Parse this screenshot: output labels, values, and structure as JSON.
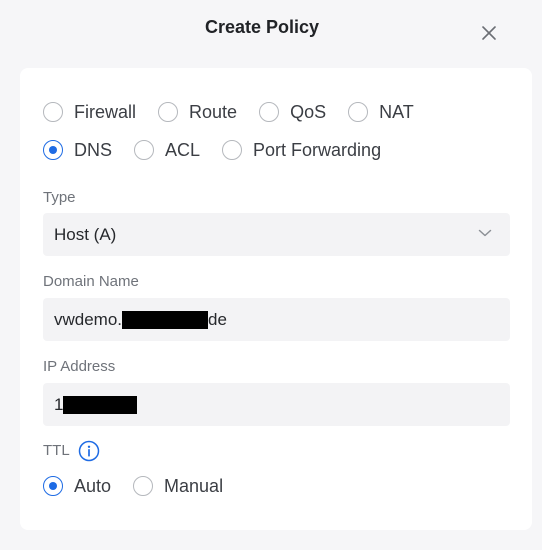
{
  "dialog": {
    "title": "Create Policy"
  },
  "policy_types": {
    "row1": [
      {
        "label": "Firewall",
        "selected": false
      },
      {
        "label": "Route",
        "selected": false
      },
      {
        "label": "QoS",
        "selected": false
      },
      {
        "label": "NAT",
        "selected": false
      }
    ],
    "row2": [
      {
        "label": "DNS",
        "selected": true
      },
      {
        "label": "ACL",
        "selected": false
      },
      {
        "label": "Port Forwarding",
        "selected": false
      }
    ]
  },
  "type_field": {
    "label": "Type",
    "value": "Host (A)"
  },
  "domain_field": {
    "label": "Domain Name",
    "value_prefix": "vwdemo.",
    "value_suffix": "de"
  },
  "ip_field": {
    "label": "IP Address",
    "value_prefix": "1"
  },
  "ttl": {
    "label": "TTL",
    "options": [
      {
        "label": "Auto",
        "selected": true
      },
      {
        "label": "Manual",
        "selected": false
      }
    ]
  },
  "colors": {
    "accent": "#1e6be4",
    "card": "#ffffff",
    "field_bg": "#f3f3f5"
  }
}
